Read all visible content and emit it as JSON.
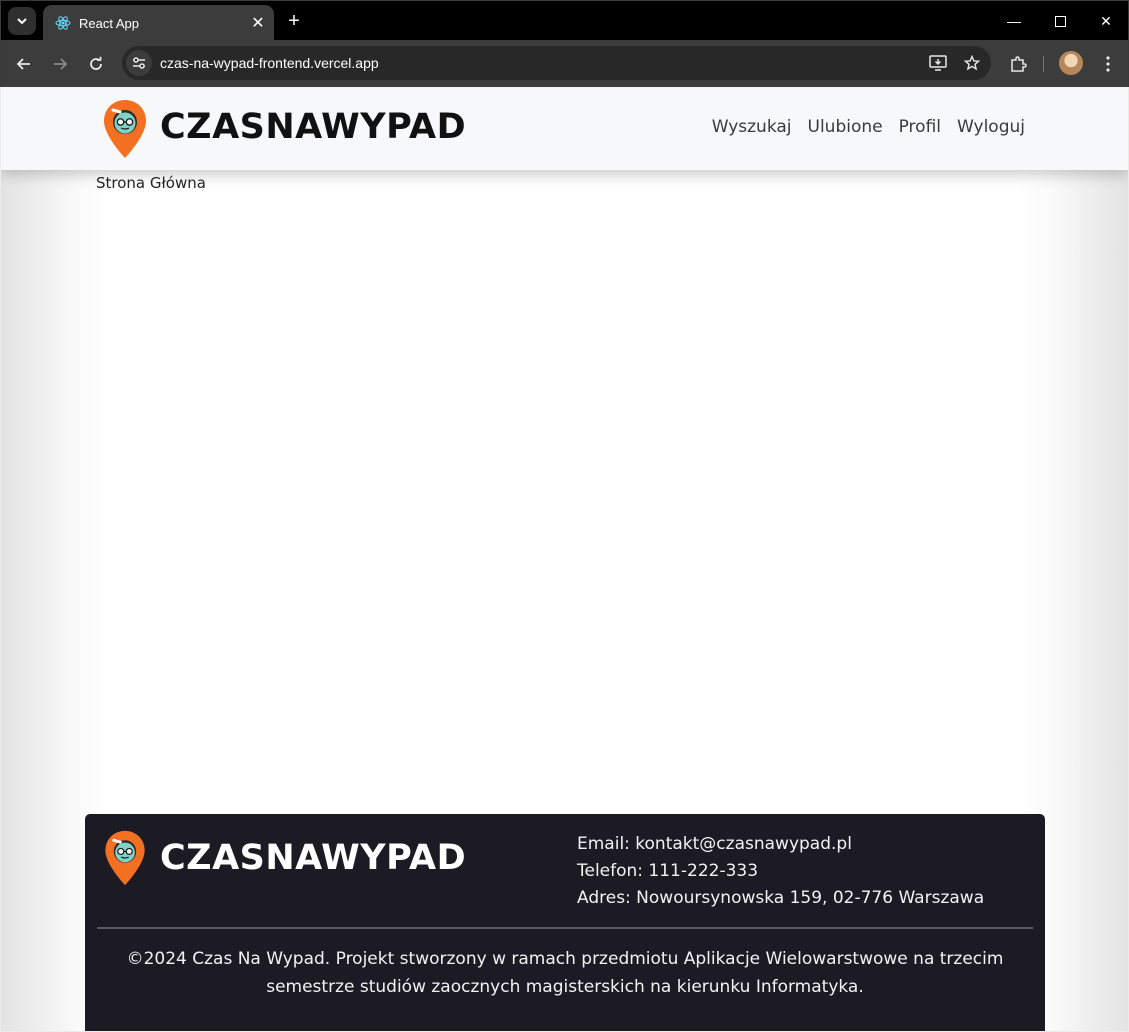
{
  "browser": {
    "tab_title": "React App",
    "url": "czas-na-wypad-frontend.vercel.app"
  },
  "header": {
    "brand": "CZASNAWYPAD",
    "nav": [
      "Wyszukaj",
      "Ulubione",
      "Profil",
      "Wyloguj"
    ]
  },
  "page": {
    "heading": "Strona Główna"
  },
  "footer": {
    "brand": "CZASNAWYPAD",
    "email": "Email: kontakt@czasnawypad.pl",
    "phone": "Telefon: 111-222-333",
    "address": "Adres: Nowoursynowska 159, 02-776 Warszawa",
    "copyright": "©2024 Czas Na Wypad. Projekt stworzony w ramach przedmiotu Aplikacje Wielowarstwowe na trzecim semestrze studiów zaocznych magisterskich na kierunku Informatyka."
  },
  "colors": {
    "accent": "#f36f21",
    "footer_bg": "#1c1b24",
    "header_bg": "#f7f8f9"
  }
}
